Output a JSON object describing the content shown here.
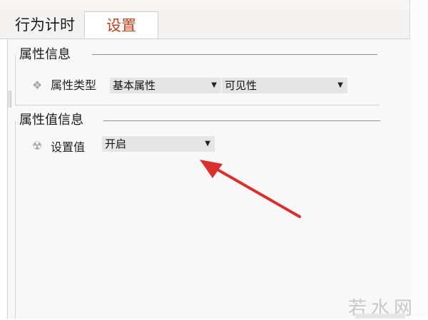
{
  "tabs": [
    {
      "label": "行为计时",
      "active": false
    },
    {
      "label": "设置",
      "active": true
    }
  ],
  "sections": {
    "attribute_info": {
      "title": "属性信息",
      "row": {
        "label": "属性类型",
        "combo1_value": "基本属性",
        "combo2_value": "可见性"
      }
    },
    "attribute_value_info": {
      "title": "属性值信息",
      "row": {
        "label": "设置值",
        "combo_value": "开启"
      }
    }
  },
  "icons": {
    "attribute_type": "diamond-cluster-icon",
    "set_value": "radiation-icon",
    "dropdown": "dropdown-arrow-icon"
  },
  "colors": {
    "active_tab_text": "#c0401a",
    "annotation_arrow": "#d9302e"
  },
  "watermark": "若水网"
}
